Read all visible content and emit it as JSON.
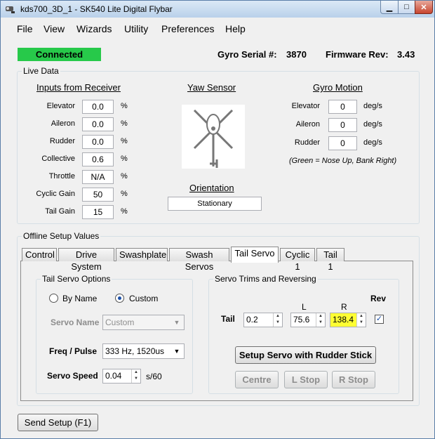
{
  "window": {
    "title": "kds700_3D_1 - SK540 Lite Digital Flybar"
  },
  "menu": [
    "File",
    "View",
    "Wizards",
    "Utility",
    "Preferences",
    "Help"
  ],
  "status": {
    "label": "Connected",
    "color": "#27c94a"
  },
  "gyro": {
    "serial_label": "Gyro Serial #:",
    "serial_value": "3870",
    "fw_label": "Firmware Rev:",
    "fw_value": "3.43"
  },
  "live": {
    "group_label": "Live Data",
    "inputs_title": "Inputs from Receiver",
    "inputs": [
      {
        "label": "Elevator",
        "value": "0.0",
        "unit": "%"
      },
      {
        "label": "Aileron",
        "value": "0.0",
        "unit": "%"
      },
      {
        "label": "Rudder",
        "value": "0.0",
        "unit": "%"
      },
      {
        "label": "Collective",
        "value": "0.6",
        "unit": "%"
      },
      {
        "label": "Throttle",
        "value": "N/A",
        "unit": "%"
      },
      {
        "label": "Cyclic Gain",
        "value": "50",
        "unit": "%"
      },
      {
        "label": "Tail Gain",
        "value": "15",
        "unit": "%"
      }
    ],
    "yaw_title": "Yaw Sensor",
    "orientation_title": "Orientation",
    "orientation_value": "Stationary",
    "motion_title": "Gyro Motion",
    "motion": [
      {
        "label": "Elevator",
        "value": "0",
        "unit": "deg/s"
      },
      {
        "label": "Aileron",
        "value": "0",
        "unit": "deg/s"
      },
      {
        "label": "Rudder",
        "value": "0",
        "unit": "deg/s"
      }
    ],
    "motion_note": "(Green = Nose Up, Bank Right)"
  },
  "offline": {
    "group_label": "Offline Setup Values",
    "tabs": [
      "Control",
      "Drive System",
      "Swashplate",
      "Swash Servos",
      "Tail Servo",
      "Cyclic 1",
      "Tail 1"
    ],
    "active_tab": "Tail Servo"
  },
  "tail_options": {
    "group_label": "Tail Servo Options",
    "radio_by_name": "By Name",
    "radio_custom": "Custom",
    "servo_name_label": "Servo Name",
    "servo_name_value": "Custom",
    "freq_label": "Freq / Pulse",
    "freq_value": "333 Hz, 1520us",
    "speed_label": "Servo Speed",
    "speed_value": "0.04",
    "speed_unit": "s/60"
  },
  "trims": {
    "group_label": "Servo Trims and Reversing",
    "col_l": "L",
    "col_r": "R",
    "col_rev": "Rev",
    "row_label": "Tail",
    "trim_value": "0.2",
    "l_value": "75.6",
    "r_value": "138.4",
    "r_highlight": "#ffff33",
    "setup_btn": "Setup Servo with Rudder Stick",
    "centre_btn": "Centre",
    "lstop_btn": "L Stop",
    "rstop_btn": "R Stop"
  },
  "footer": {
    "send_btn": "Send Setup (F1)"
  }
}
